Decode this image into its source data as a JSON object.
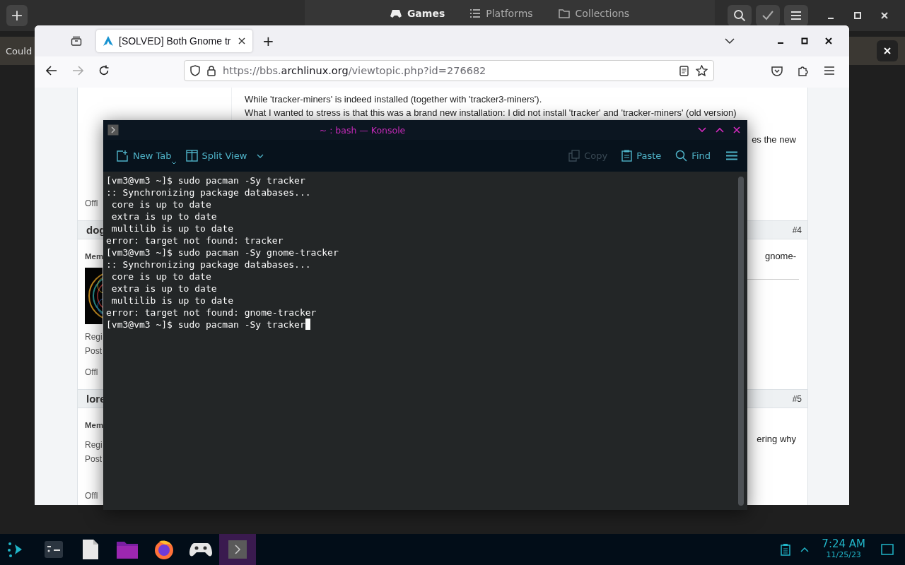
{
  "games_app": {
    "new_button": "+",
    "tabs": [
      {
        "label": "Games",
        "selected": true
      },
      {
        "label": "Platforms",
        "selected": false
      },
      {
        "label": "Collections",
        "selected": false
      }
    ],
    "notification": "Could"
  },
  "browser": {
    "tab": {
      "title": "[SOLVED] Both Gnome tr",
      "selected": true
    },
    "new_tab": "+",
    "forward_disabled": true,
    "url": {
      "prefix": "https://bbs.",
      "domain": "archlinux.org",
      "path": "/viewtopic.php?id=276682"
    },
    "page": {
      "post_lines": [
        "While 'tracker-miners' is indeed installed (together with 'tracker3-miners').",
        "What I wanted to stress is that this was a brand new installation: I did not install 'tracker' and 'tracker-miners' (old version)"
      ],
      "post_fragment": "es the new",
      "post_status": "Offl",
      "posts": [
        {
          "author": "dog",
          "number": "#4",
          "role": "Mem",
          "has_avatar": true,
          "registered": "Regi",
          "posts": "Post",
          "status": "Offl",
          "text": "gnome-",
          "has_rule": true
        },
        {
          "author": "lore",
          "number": "#5",
          "role": "Mem",
          "has_avatar": false,
          "registered": "Regi",
          "posts": "Post",
          "status": "Offl",
          "text": "ering why",
          "has_rule": false
        }
      ]
    }
  },
  "konsole": {
    "title": "~ : bash — Konsole",
    "toolbar": [
      {
        "kind": "new-tab",
        "label": "New Tab",
        "disabled": false
      },
      {
        "kind": "split",
        "label": "Split View",
        "disabled": false
      },
      {
        "kind": "copy",
        "label": "Copy",
        "disabled": true
      },
      {
        "kind": "paste",
        "label": "Paste",
        "disabled": false
      },
      {
        "kind": "find",
        "label": "Find",
        "disabled": false
      }
    ],
    "lines": [
      "[vm3@vm3 ~]$ sudo pacman -Sy tracker",
      ":: Synchronizing package databases...",
      " core is up to date",
      " extra is up to date",
      " multilib is up to date",
      "error: target not found: tracker",
      "[vm3@vm3 ~]$ sudo pacman -Sy gnome-tracker",
      ":: Synchronizing package databases...",
      " core is up to date",
      " extra is up to date",
      " multilib is up to date",
      "error: target not found: gnome-tracker",
      "[vm3@vm3 ~]$ sudo pacman -Sy tracker"
    ],
    "cursor_visible": true
  },
  "taskbar": {
    "apps": [
      {
        "kind": "terminal-window",
        "selected": false
      },
      {
        "kind": "document",
        "selected": false
      },
      {
        "kind": "folder",
        "selected": false
      },
      {
        "kind": "browser",
        "selected": false
      },
      {
        "kind": "gamepad",
        "selected": false
      },
      {
        "kind": "konsole",
        "selected": true
      }
    ],
    "time": "7:24 AM",
    "date": "11/25/23"
  }
}
